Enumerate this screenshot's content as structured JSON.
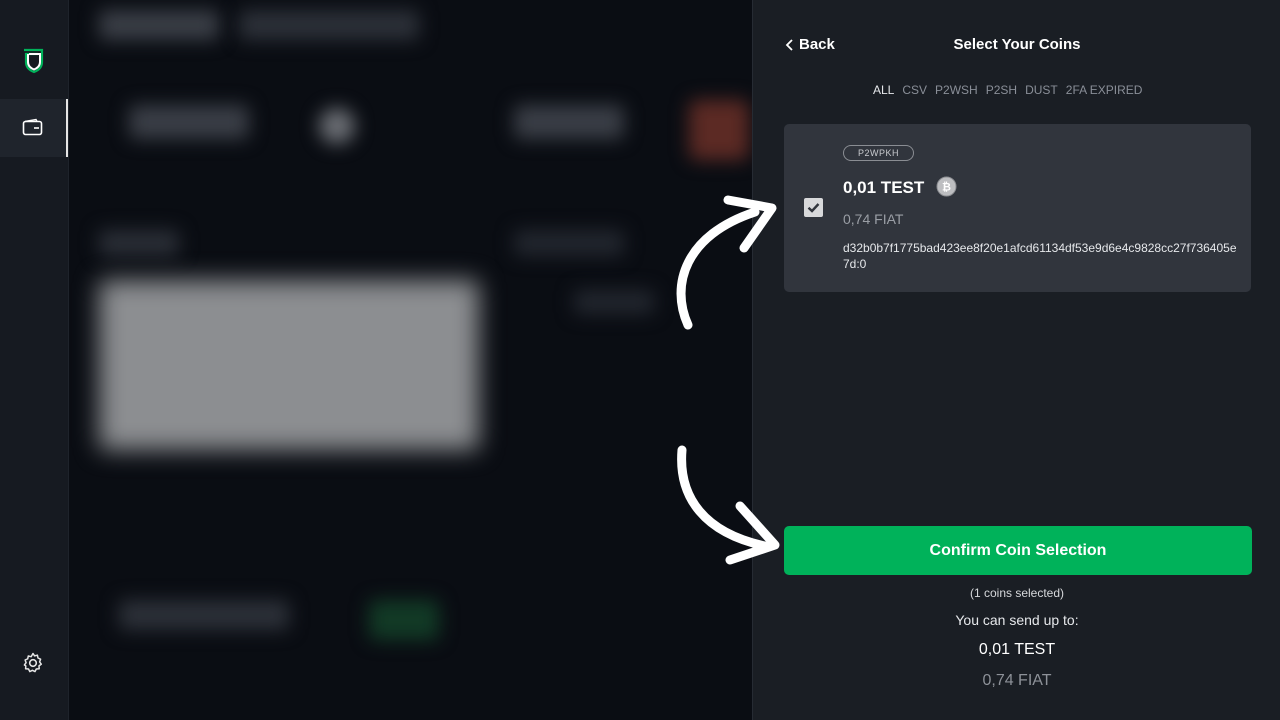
{
  "sidebar": {
    "logo_icon": "shield-logo-icon",
    "wallet_icon": "wallet-icon",
    "settings_icon": "gear-icon",
    "accent": "#00b25a"
  },
  "panel": {
    "back_label": "Back",
    "title": "Select Your Coins",
    "filters": [
      "ALL",
      "CSV",
      "P2WSH",
      "P2SH",
      "DUST",
      "2FA EXPIRED"
    ],
    "active_filter": "ALL"
  },
  "coin": {
    "checked": true,
    "type_tag": "P2WPKH",
    "amount": "0,01 TEST",
    "icon": "bitcoin-icon",
    "fiat": "0,74 FIAT",
    "txid": "d32b0b7f1775bad423ee8f20e1afcd61134df53e9d6e4c9828cc27f736405e7d:0"
  },
  "footer": {
    "confirm_label": "Confirm Coin Selection",
    "selected_count": "(1 coins selected)",
    "send_up_label": "You can send up to:",
    "send_amount": "0,01 TEST",
    "send_fiat": "0,74 FIAT"
  },
  "colors": {
    "confirm_bg": "#00b25a",
    "panel_bg": "#1a1e24",
    "card_bg": "#31353d"
  }
}
